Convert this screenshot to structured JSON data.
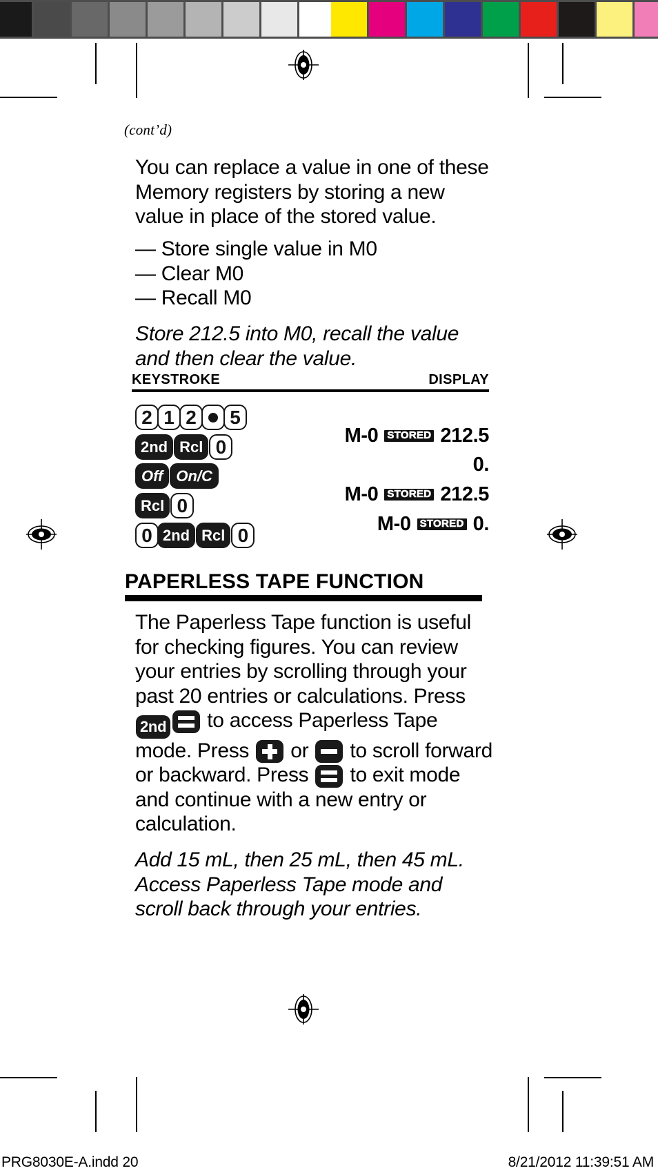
{
  "page": {
    "cont_label": "(cont’d)",
    "intro_paragraph": "You can replace a value in one of these Memory registers by storing a new value in place of the stored value.",
    "bullets": [
      "— Store single value in M0",
      "— Clear M0",
      "— Recall M0"
    ],
    "example_italic": "Store 212.5 into M0, recall the value and then clear the value."
  },
  "table": {
    "header_keystroke": "KEYSTROKE",
    "header_display": "DISPLAY",
    "rows": [
      {
        "keys": [
          {
            "label": "2",
            "style": "light"
          },
          {
            "label": "1",
            "style": "light"
          },
          {
            "label": "2",
            "style": "light"
          },
          {
            "label": "•",
            "style": "light-dot"
          },
          {
            "label": "5",
            "style": "light"
          }
        ],
        "display": {
          "left": "",
          "badge": "",
          "value": ""
        }
      },
      {
        "keys": [
          {
            "label": "2nd",
            "style": "dark"
          },
          {
            "label": "Rcl",
            "style": "dark"
          },
          {
            "label": "0",
            "style": "light"
          }
        ],
        "display": {
          "left": "M-0",
          "badge": "STORED",
          "value": "212.5"
        }
      },
      {
        "keys": [
          {
            "label": "Off",
            "style": "dark-italic"
          },
          {
            "label": "On/C",
            "style": "dark-italic"
          }
        ],
        "display": {
          "left": "",
          "badge": "",
          "value": "0."
        }
      },
      {
        "keys": [
          {
            "label": "Rcl",
            "style": "dark"
          },
          {
            "label": "0",
            "style": "light"
          }
        ],
        "display": {
          "left": "M-0",
          "badge": "STORED",
          "value": "212.5"
        }
      },
      {
        "keys": [
          {
            "label": "0",
            "style": "light"
          },
          {
            "label": "2nd",
            "style": "dark"
          },
          {
            "label": "Rcl",
            "style": "dark"
          },
          {
            "label": "0",
            "style": "light"
          }
        ],
        "display": {
          "left": "M-0",
          "badge": "STORED",
          "value": "0."
        }
      }
    ]
  },
  "section": {
    "heading": "PAPERLESS TAPE FUNCTION",
    "para_1": "The Paperless Tape function is useful for checking figures. You can review your entries by scrolling through your past 20 entries or calculations. Press",
    "para_2": "to access Paperless Tape mode. Press",
    "para_3": "or",
    "para_4": "to scroll forward or backward. Press",
    "para_5": "to exit mode and continue with a new entry or calculation.",
    "key_2nd": "2nd",
    "example_italic": "Add 15 mL, then 25 mL, then 45 mL. Access Paperless Tape mode and scroll back through your entries."
  },
  "footer": {
    "left": "PRG8030E-A.indd   20",
    "right": "8/21/2012   11:39:51 AM"
  },
  "calibration": {
    "grayscale": [
      "#1a1a1a",
      "#4a4a4a",
      "#686868",
      "#8a8a8a",
      "#9b9b9b",
      "#b4b4b4",
      "#cccccc",
      "#e8e8e8",
      "#ffffff"
    ],
    "colors": [
      "#ffe800",
      "#e5007e",
      "#00a7e7",
      "#2e3192",
      "#00a04a",
      "#e8201c",
      "#1f1a1a",
      "#fcf07e",
      "#f27eb8"
    ]
  }
}
